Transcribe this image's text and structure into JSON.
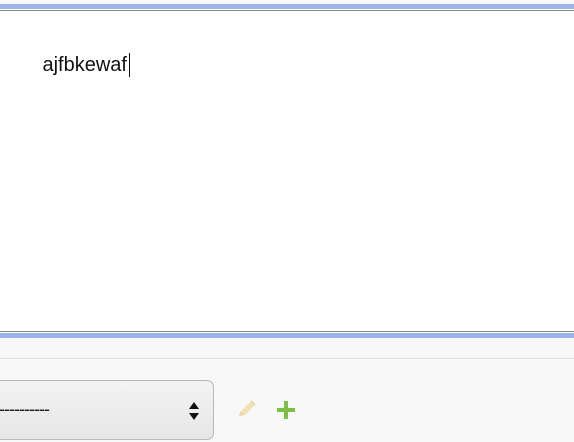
{
  "editor": {
    "text": "ajfbkewaf"
  },
  "select": {
    "selected_value": "----------",
    "icon": "up-down-arrows-icon"
  },
  "actions": {
    "edit_icon": "pencil-icon",
    "add_icon": "plus-icon",
    "edit_color": "#f2e3b7",
    "add_color": "#7cbf45"
  },
  "colors": {
    "editor_border": "#9db4ea"
  }
}
